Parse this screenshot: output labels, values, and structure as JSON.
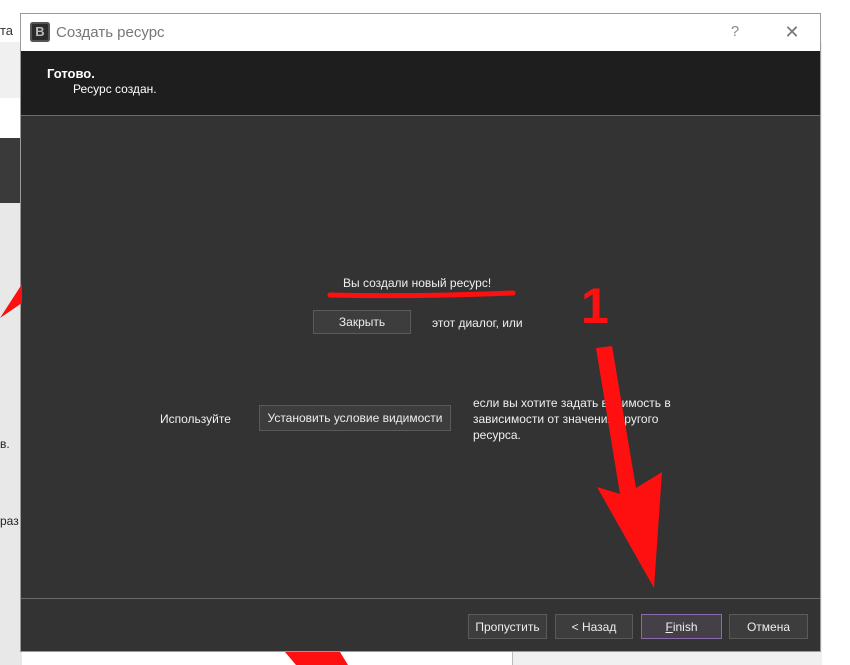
{
  "background": {
    "top_text": "та",
    "side_texts": [
      "в.",
      "раз"
    ]
  },
  "dialog": {
    "title": "Создать ресурс",
    "help_label": "?",
    "close_label": "✕",
    "app_icon_letter": "B",
    "header": {
      "title": "Готово.",
      "subtitle": "Ресурс создан."
    },
    "body": {
      "created_message": "Вы создали новый ресурс!",
      "close_button": "Закрыть",
      "close_suffix": "этот диалог, или",
      "use_label": "Используйте",
      "visibility_button": "Установить условие видимости",
      "visibility_hint_1": "если вы хотите задать видимость в",
      "visibility_hint_2": "зависимости от значения другого",
      "visibility_hint_3": "ресурса."
    },
    "footer": {
      "skip_button": "Пропустить",
      "back_button": "< Назад",
      "finish_first": "F",
      "finish_rest": "inish",
      "cancel_button": "Отмена"
    }
  },
  "annotation": {
    "marker": "1",
    "color": "#ff1010"
  },
  "colors": {
    "dialog_bg": "#333333",
    "header_bg": "#1e1e1e",
    "accent_border": "#8a6aa8"
  }
}
